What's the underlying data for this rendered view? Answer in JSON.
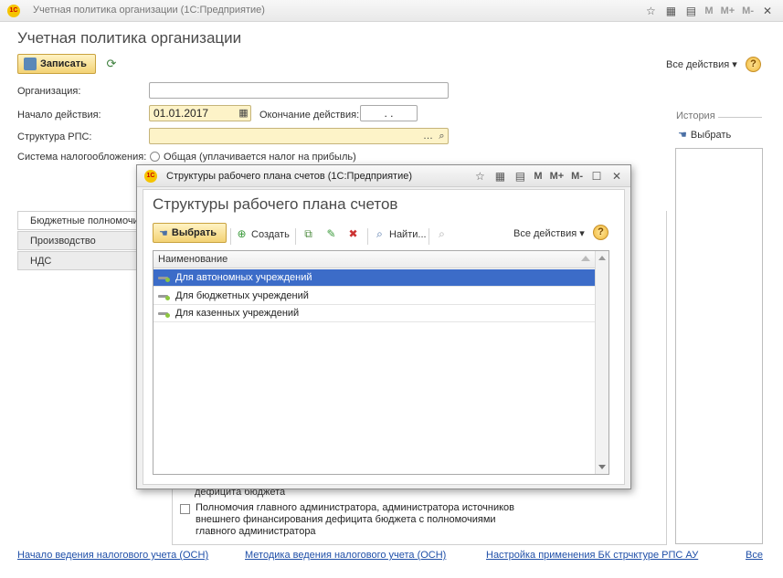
{
  "window": {
    "title": "Учетная политика организации  (1С:Предприятие)",
    "toolbar_markers": [
      "M",
      "M+",
      "M-"
    ]
  },
  "form": {
    "title": "Учетная политика организации",
    "save_label": "Записать",
    "all_actions": "Все действия",
    "help": "?",
    "organization_label": "Организация:",
    "organization_value": "",
    "start_label": "Начало действия:",
    "start_value": "01.01.2017",
    "end_label": "Окончание действия:",
    "end_value": ". .",
    "rps_label": "Структура РПС:",
    "rps_value": "",
    "tax_label": "Система налогообложения:",
    "tax_option": "Общая (уплачивается налог на прибыль)"
  },
  "history": {
    "title": "История",
    "select_label": "Выбрать"
  },
  "tabs": [
    {
      "label": "Бюджетные полномочия"
    },
    {
      "label": "Производство"
    },
    {
      "label": "НДС"
    }
  ],
  "checkboxes": {
    "partial_text": "дефицита бюджета",
    "item_text": "Полномочия главного администратора, администратора источников внешнего финансирования дефицита бюджета с полномочиями главного администратора"
  },
  "footer_links": [
    "Начало ведения налогового учета (ОСН)",
    "Методика ведения налогового учета (ОСН)",
    "Настройка применения БК стрчктуре РПС АУ",
    "Все"
  ],
  "dialog": {
    "title": "Структуры рабочего плана счетов  (1С:Предприятие)",
    "heading": "Структуры рабочего плана счетов",
    "select_label": "Выбрать",
    "create_label": "Создать",
    "find_label": "Найти...",
    "all_actions": "Все действия",
    "help": "?",
    "column_header": "Наименование",
    "rows": [
      {
        "name": "Для автономных учреждений",
        "selected": true
      },
      {
        "name": "Для бюджетных учреждений",
        "selected": false
      },
      {
        "name": "Для казенных учреждений",
        "selected": false
      }
    ]
  },
  "colors": {
    "accent_yellow": "#f3d274",
    "selection_blue": "#3c6cc8",
    "link_blue": "#1f4fa8"
  }
}
